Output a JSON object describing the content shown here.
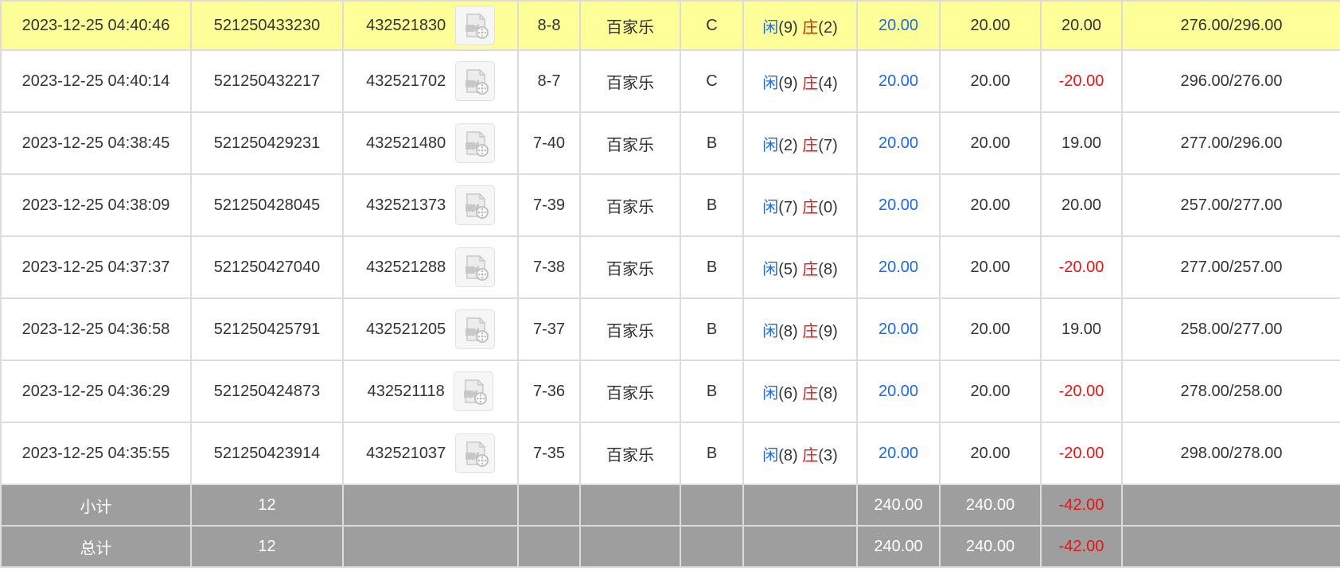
{
  "rows": [
    {
      "time": "2023-12-25 04:40:46",
      "bet_id": "521250433230",
      "round_id": "432521830",
      "shoe": "8-8",
      "game": "百家乐",
      "table": "C",
      "player_label": "闲",
      "player_pts": "(9)",
      "banker_label": "庄",
      "banker_pts": "(2)",
      "bet": "20.00",
      "valid": "20.00",
      "win": "20.00",
      "win_neg": false,
      "balance": "276.00/296.00",
      "highlight": true
    },
    {
      "time": "2023-12-25 04:40:14",
      "bet_id": "521250432217",
      "round_id": "432521702",
      "shoe": "8-7",
      "game": "百家乐",
      "table": "C",
      "player_label": "闲",
      "player_pts": "(9)",
      "banker_label": "庄",
      "banker_pts": "(4)",
      "bet": "20.00",
      "valid": "20.00",
      "win": "-20.00",
      "win_neg": true,
      "balance": "296.00/276.00",
      "highlight": false
    },
    {
      "time": "2023-12-25 04:38:45",
      "bet_id": "521250429231",
      "round_id": "432521480",
      "shoe": "7-40",
      "game": "百家乐",
      "table": "B",
      "player_label": "闲",
      "player_pts": "(2)",
      "banker_label": "庄",
      "banker_pts": "(7)",
      "bet": "20.00",
      "valid": "20.00",
      "win": "19.00",
      "win_neg": false,
      "balance": "277.00/296.00",
      "highlight": false
    },
    {
      "time": "2023-12-25 04:38:09",
      "bet_id": "521250428045",
      "round_id": "432521373",
      "shoe": "7-39",
      "game": "百家乐",
      "table": "B",
      "player_label": "闲",
      "player_pts": "(7)",
      "banker_label": "庄",
      "banker_pts": "(0)",
      "bet": "20.00",
      "valid": "20.00",
      "win": "20.00",
      "win_neg": false,
      "balance": "257.00/277.00",
      "highlight": false
    },
    {
      "time": "2023-12-25 04:37:37",
      "bet_id": "521250427040",
      "round_id": "432521288",
      "shoe": "7-38",
      "game": "百家乐",
      "table": "B",
      "player_label": "闲",
      "player_pts": "(5)",
      "banker_label": "庄",
      "banker_pts": "(8)",
      "bet": "20.00",
      "valid": "20.00",
      "win": "-20.00",
      "win_neg": true,
      "balance": "277.00/257.00",
      "highlight": false
    },
    {
      "time": "2023-12-25 04:36:58",
      "bet_id": "521250425791",
      "round_id": "432521205",
      "shoe": "7-37",
      "game": "百家乐",
      "table": "B",
      "player_label": "闲",
      "player_pts": "(8)",
      "banker_label": "庄",
      "banker_pts": "(9)",
      "bet": "20.00",
      "valid": "20.00",
      "win": "19.00",
      "win_neg": false,
      "balance": "258.00/277.00",
      "highlight": false
    },
    {
      "time": "2023-12-25 04:36:29",
      "bet_id": "521250424873",
      "round_id": "432521118",
      "shoe": "7-36",
      "game": "百家乐",
      "table": "B",
      "player_label": "闲",
      "player_pts": "(6)",
      "banker_label": "庄",
      "banker_pts": "(8)",
      "bet": "20.00",
      "valid": "20.00",
      "win": "-20.00",
      "win_neg": true,
      "balance": "278.00/258.00",
      "highlight": false
    },
    {
      "time": "2023-12-25 04:35:55",
      "bet_id": "521250423914",
      "round_id": "432521037",
      "shoe": "7-35",
      "game": "百家乐",
      "table": "B",
      "player_label": "闲",
      "player_pts": "(8)",
      "banker_label": "庄",
      "banker_pts": "(3)",
      "bet": "20.00",
      "valid": "20.00",
      "win": "-20.00",
      "win_neg": true,
      "balance": "298.00/278.00",
      "highlight": false
    }
  ],
  "subtotal": {
    "label": "小计",
    "count": "12",
    "bet": "240.00",
    "valid": "240.00",
    "win": "-42.00"
  },
  "total": {
    "label": "总计",
    "count": "12",
    "bet": "240.00",
    "valid": "240.00",
    "win": "-42.00"
  },
  "colors": {
    "highlight_row": "#ffff99",
    "player": "#1a6be0",
    "banker": "#ee1111",
    "negative": "#ee1111",
    "summary_bg": "#9e9e9e"
  },
  "icons": {
    "video": "video-replay-icon"
  }
}
